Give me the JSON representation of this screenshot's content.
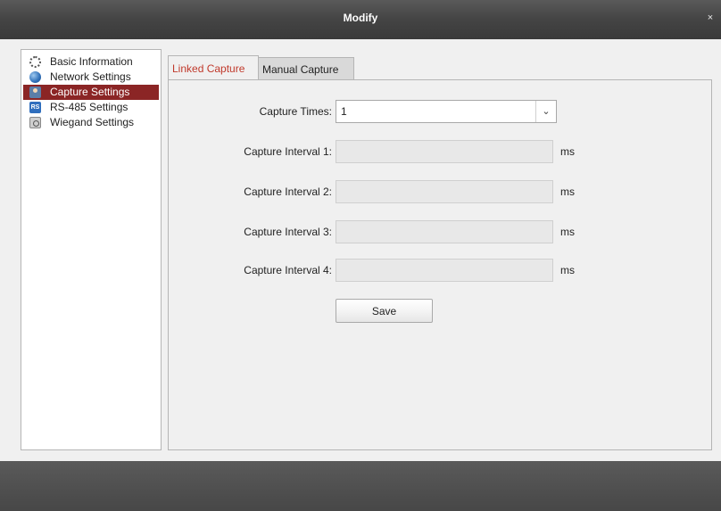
{
  "window": {
    "title": "Modify",
    "close_glyph": "×"
  },
  "sidebar": {
    "items": [
      {
        "label": "Basic Information",
        "icon": "gear-icon",
        "active": false
      },
      {
        "label": "Network Settings",
        "icon": "globe-icon",
        "active": false
      },
      {
        "label": "Capture Settings",
        "icon": "person-icon",
        "active": true
      },
      {
        "label": "RS-485 Settings",
        "icon": "rs-icon",
        "icon_text": "RS",
        "active": false
      },
      {
        "label": "Wiegand Settings",
        "icon": "wiegand-icon",
        "active": false
      }
    ]
  },
  "tabs": [
    {
      "label": "Linked Capture",
      "active": true
    },
    {
      "label": "Manual Capture",
      "active": false
    }
  ],
  "form": {
    "capture_times_label": "Capture Times:",
    "capture_times_value": "1",
    "intervals": [
      {
        "label": "Capture Interval 1:",
        "value": "",
        "unit": "ms"
      },
      {
        "label": "Capture Interval 2:",
        "value": "",
        "unit": "ms"
      },
      {
        "label": "Capture Interval 3:",
        "value": "",
        "unit": "ms"
      },
      {
        "label": "Capture Interval 4:",
        "value": "",
        "unit": "ms"
      }
    ],
    "save_label": "Save"
  },
  "colors": {
    "active_item": "#8b2525",
    "active_tab_text": "#c0392b"
  }
}
